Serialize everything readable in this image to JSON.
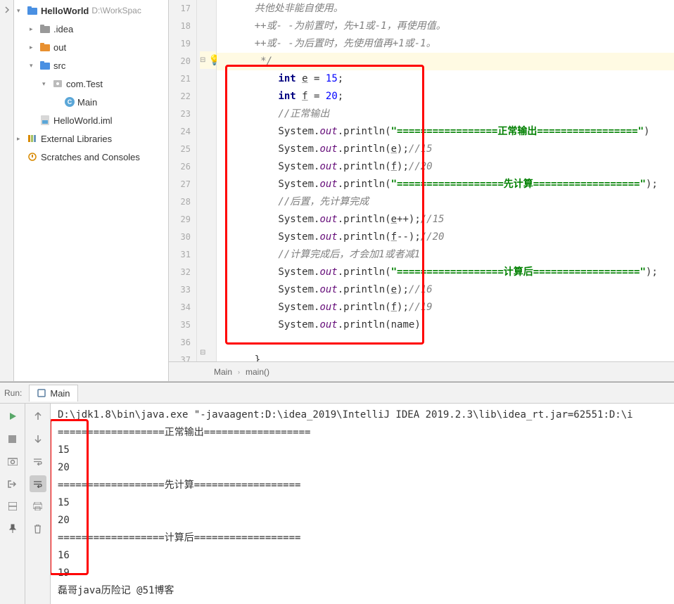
{
  "project": {
    "root": {
      "name": "HelloWorld",
      "path": "D:\\WorkSpac"
    },
    "children": [
      {
        "name": ".idea",
        "type": "folder",
        "expand": "right",
        "color": "grey"
      },
      {
        "name": "out",
        "type": "folder",
        "expand": "right",
        "color": "orange"
      },
      {
        "name": "src",
        "type": "folder",
        "expand": "down",
        "color": "blue",
        "children": [
          {
            "name": "com.Test",
            "type": "package",
            "expand": "down",
            "children": [
              {
                "name": "Main",
                "type": "class"
              }
            ]
          }
        ]
      },
      {
        "name": "HelloWorld.iml",
        "type": "iml"
      }
    ],
    "libs": "External Libraries",
    "scratches": "Scratches and Consoles"
  },
  "editor": {
    "lines": [
      17,
      18,
      19,
      20,
      21,
      22,
      23,
      24,
      25,
      26,
      27,
      28,
      29,
      30,
      31,
      32,
      33,
      34,
      35,
      36,
      37
    ],
    "bulb_line": 20,
    "code": {
      "c17": "    共他处非能自使用。",
      "c18_a": "    ++或- -为前置时，先+",
      "c18_b": "1",
      "c18_c": "或-",
      "c18_d": "1",
      "c18_e": "，再使用值。",
      "c19_a": "    ++或- -为后置时，先使用值再+",
      "c19_b": "1",
      "c19_c": "或-",
      "c19_d": "1",
      "c19_e": "。",
      "c20": "     */",
      "c21_a": "        ",
      "c21_kw": "int",
      "c21_b": " ",
      "c21_v": "e",
      "c21_c": " = ",
      "c21_n": "15",
      "c21_d": ";",
      "c22_a": "        ",
      "c22_kw": "int",
      "c22_b": " ",
      "c22_v": "f",
      "c22_c": " = ",
      "c22_n": "20",
      "c22_d": ";",
      "c23": "        //正常输出",
      "c24_a": "        System.",
      "c24_o": "out",
      "c24_b": ".println(",
      "c24_s": "\"==========",
      "c24_s2": "=======正常输出=================\"",
      "c24_c": ")",
      "c25_a": "        System.",
      "c25_o": "out",
      "c25_b": ".println(",
      "c25_v": "e",
      "c25_c": ");",
      "c25_cm": "//15",
      "c26_a": "        System.",
      "c26_o": "out",
      "c26_b": ".println(",
      "c26_v": "f",
      "c26_c": ");",
      "c26_cm": "//20",
      "c27_a": "        System.",
      "c27_o": "out",
      "c27_b": ".println(",
      "c27_s": "\"==========",
      "c27_s2": "========先计算==================\"",
      "c27_c": ");",
      "c28": "        //后置，先计算完成",
      "c29_a": "        System.",
      "c29_o": "out",
      "c29_b": ".println(",
      "c29_v": "e",
      "c29_c": "++);",
      "c29_cm": "//15",
      "c30_a": "        System.",
      "c30_o": "out",
      "c30_b": ".println(",
      "c30_v": "f",
      "c30_c": "--);",
      "c30_cm": "//20",
      "c31_a": "        //计算完成后，才会加",
      "c31_n1": "1",
      "c31_b": "或者减",
      "c31_n2": "1",
      "c32_a": "        System.",
      "c32_o": "out",
      "c32_b": ".println(",
      "c32_s": "\"==========",
      "c32_s2": "========计算后==================\"",
      "c32_c": ");",
      "c33_a": "        System.",
      "c33_o": "out",
      "c33_b": ".println(",
      "c33_v": "e",
      "c33_c": ");",
      "c33_cm": "//16",
      "c34_a": "        System.",
      "c34_o": "out",
      "c34_b": ".println(",
      "c34_v": "f",
      "c34_c": ");",
      "c34_cm": "//19",
      "c35_a": "        System.",
      "c35_o": "out",
      "c35_b": ".println(",
      "c35_v": "name",
      "c35_c": ");",
      "c36": "",
      "c37": "    }"
    }
  },
  "breadcrumb": {
    "a": "Main",
    "sep": "›",
    "b": "main()"
  },
  "run": {
    "label": "Run:",
    "tab": "Main",
    "console": {
      "l0": "D:\\jdk1.8\\bin\\java.exe \"-javaagent:D:\\idea_2019\\IntelliJ IDEA 2019.2.3\\lib\\idea_rt.jar=62551:D:\\i",
      "l1": "==================正常输出==================",
      "l2": "15",
      "l3": "20",
      "l4": "==================先计算==================",
      "l5": "15",
      "l6": "20",
      "l7": "==================计算后==================",
      "l8": "16",
      "l9": "19",
      "l10": "磊哥java历险记 @51博客"
    }
  }
}
